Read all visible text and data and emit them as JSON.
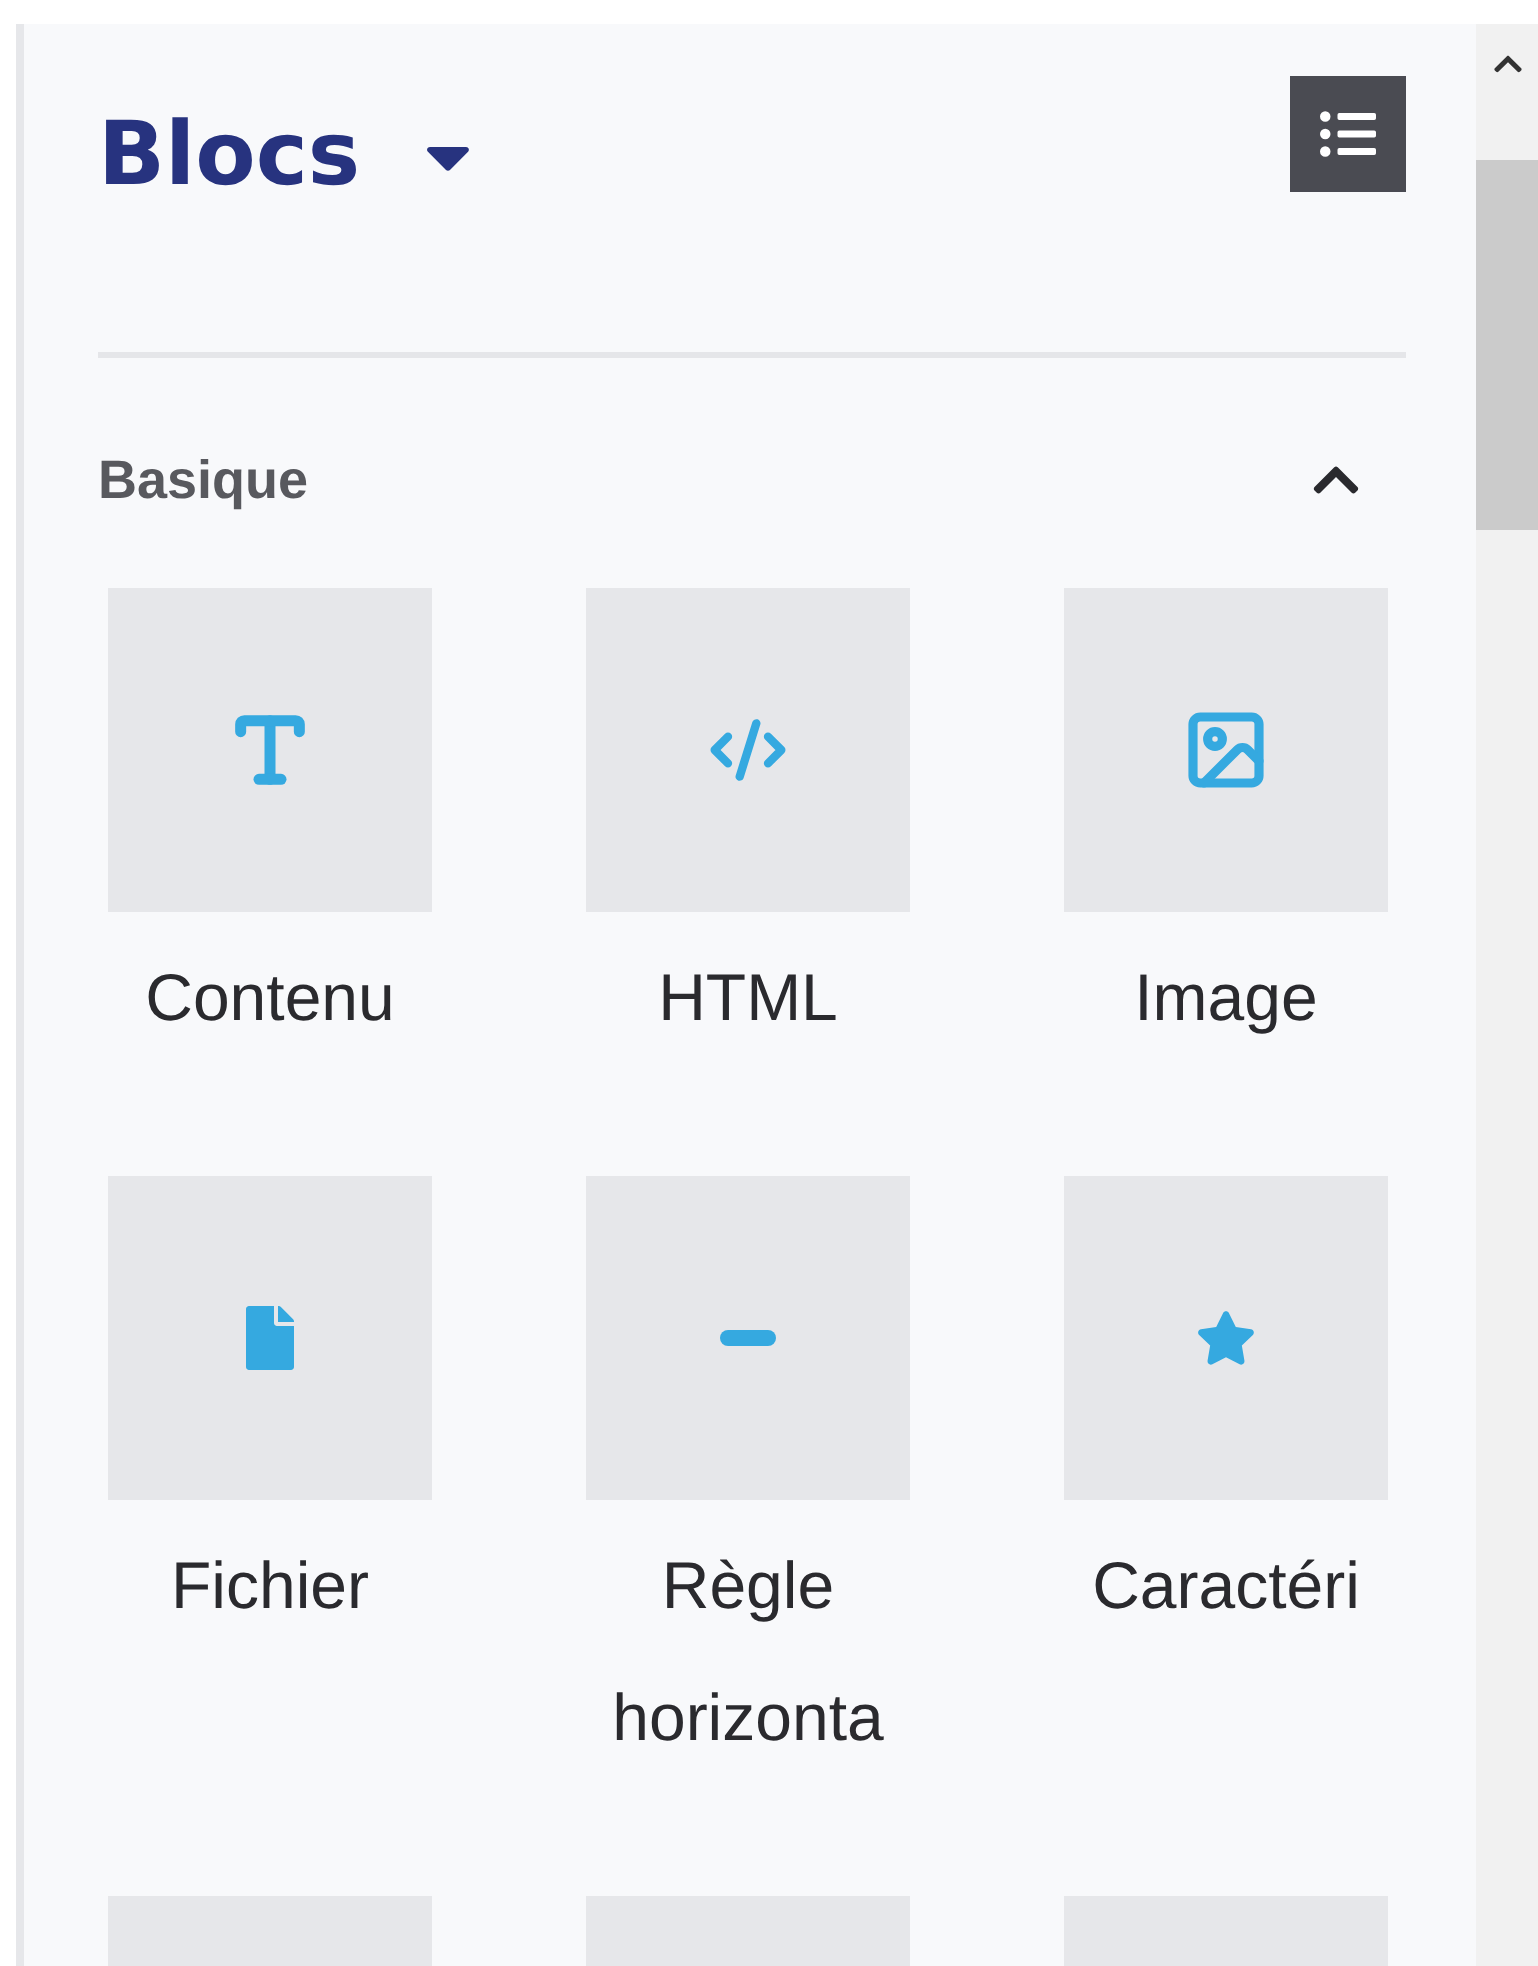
{
  "panel": {
    "title": "Blocs"
  },
  "section": {
    "title": "Basique",
    "expanded": true
  },
  "blocks": [
    {
      "kind": "text",
      "label": "Contenu"
    },
    {
      "kind": "code",
      "label": "HTML"
    },
    {
      "kind": "image",
      "label": "Image"
    },
    {
      "kind": "file",
      "label": "Fichier"
    },
    {
      "kind": "rule",
      "label": "Règle horizonta"
    },
    {
      "kind": "star",
      "label": "Caractéri"
    },
    {
      "kind": "cut"
    },
    {
      "kind": "cut"
    },
    {
      "kind": "cut"
    }
  ]
}
